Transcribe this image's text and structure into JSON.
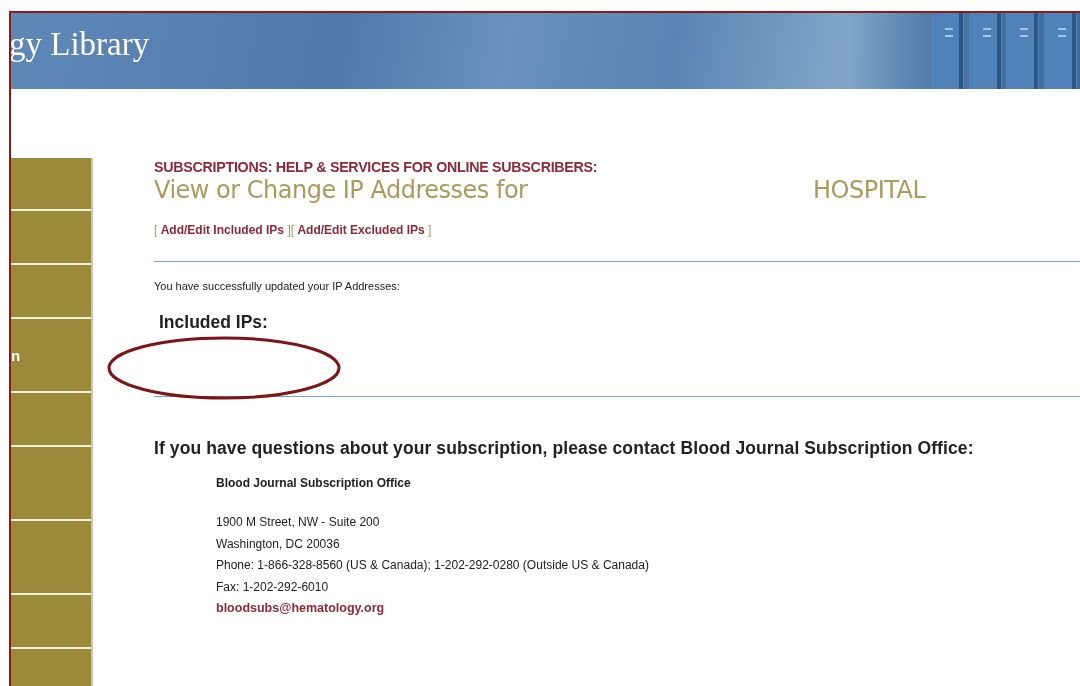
{
  "banner": {
    "title": "gy Library"
  },
  "sidebar": {
    "items": [
      {
        "kind": "blank"
      },
      {
        "kind": "blank"
      },
      {
        "kind": "blank"
      },
      {
        "kind": "text",
        "label": "n"
      },
      {
        "kind": "blank"
      },
      {
        "kind": "blank"
      },
      {
        "kind": "blank"
      },
      {
        "kind": "blank"
      },
      {
        "kind": "blank"
      }
    ]
  },
  "section_heading": "SUBSCRIPTIONS: HELP & SERVICES FOR ONLINE SUBSCRIBERS:",
  "page_title": "View or Change IP Addresses for",
  "institution": "HOSPITAL",
  "links": [
    {
      "open": "[",
      "label": "Add/Edit Included IPs",
      "close": "]"
    },
    {
      "open": "[",
      "label": "Add/Edit Excluded IPs",
      "close": "]"
    }
  ],
  "message": "You have successfully updated your IP Addresses:",
  "included_heading": "Included IPs:",
  "annotations": [
    {
      "kind": "ellipse"
    }
  ],
  "contact_heading": "If you have questions about your subscription, please contact Blood Journal Subscription Office:",
  "contact": {
    "name": "Blood Journal Subscription Office",
    "lines": [
      "1900 M Street, NW - Suite 200",
      "Washington, DC 20036",
      "Phone: 1-866-328-8560 (US & Canada); 1-202-292-0280 (Outside US & Canada)",
      "Fax: 1-202-292-6010"
    ],
    "email": "bloodsubs@hematology.org"
  }
}
